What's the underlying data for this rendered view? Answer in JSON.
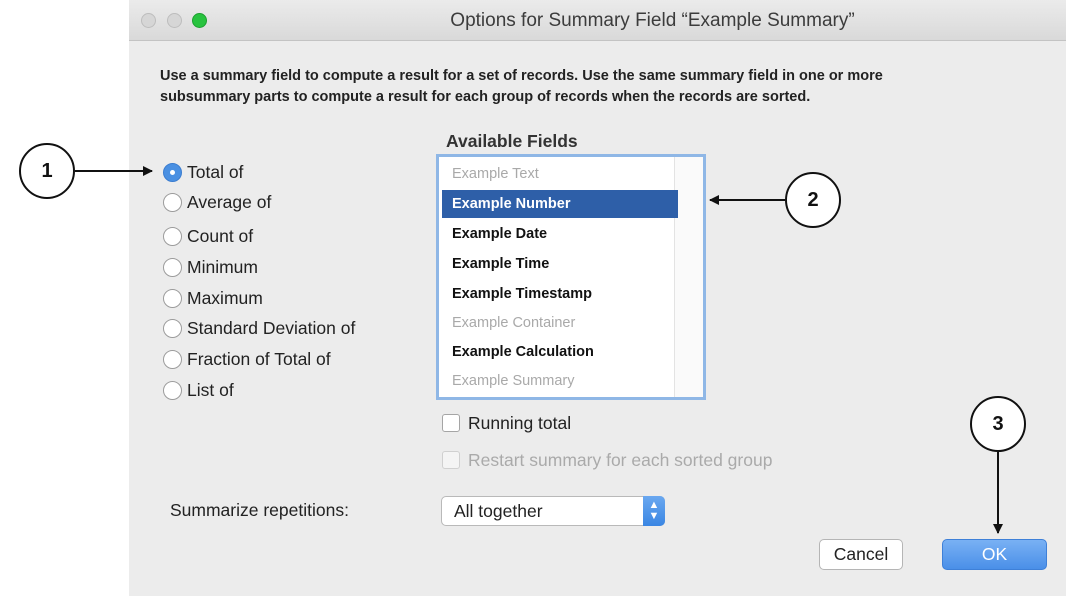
{
  "window": {
    "title": "Options for Summary Field “Example Summary”"
  },
  "description": {
    "line1": "Use a summary field to compute a result for a set of records. Use the same summary field in one or more",
    "line2": "subsummary parts to compute a result for each group of records when the records are sorted."
  },
  "summary_types": [
    {
      "label": "Total of",
      "selected": true
    },
    {
      "label": "Average of",
      "selected": false
    },
    {
      "label": "Count of",
      "selected": false
    },
    {
      "label": "Minimum",
      "selected": false
    },
    {
      "label": "Maximum",
      "selected": false
    },
    {
      "label": "Standard Deviation of",
      "selected": false
    },
    {
      "label": "Fraction of Total of",
      "selected": false
    },
    {
      "label": "List of",
      "selected": false
    }
  ],
  "available_fields": {
    "label": "Available Fields",
    "items": [
      {
        "label": "Example Text",
        "state": "disabled"
      },
      {
        "label": "Example Number",
        "state": "selected"
      },
      {
        "label": "Example Date",
        "state": "enabled"
      },
      {
        "label": "Example Time",
        "state": "enabled"
      },
      {
        "label": "Example Timestamp",
        "state": "enabled"
      },
      {
        "label": "Example Container",
        "state": "disabled"
      },
      {
        "label": "Example Calculation",
        "state": "enabled"
      },
      {
        "label": "Example Summary",
        "state": "disabled"
      }
    ]
  },
  "options": {
    "running_total": "Running total",
    "restart_summary": "Restart summary for each sorted group"
  },
  "repetitions": {
    "label": "Summarize repetitions:",
    "value": "All together"
  },
  "buttons": {
    "cancel": "Cancel",
    "ok": "OK"
  },
  "callouts": {
    "c1": "1",
    "c2": "2",
    "c3": "3"
  },
  "colors": {
    "accent": "#4a90e2",
    "selection": "#2e5fa8",
    "window_bg": "#ececec"
  }
}
